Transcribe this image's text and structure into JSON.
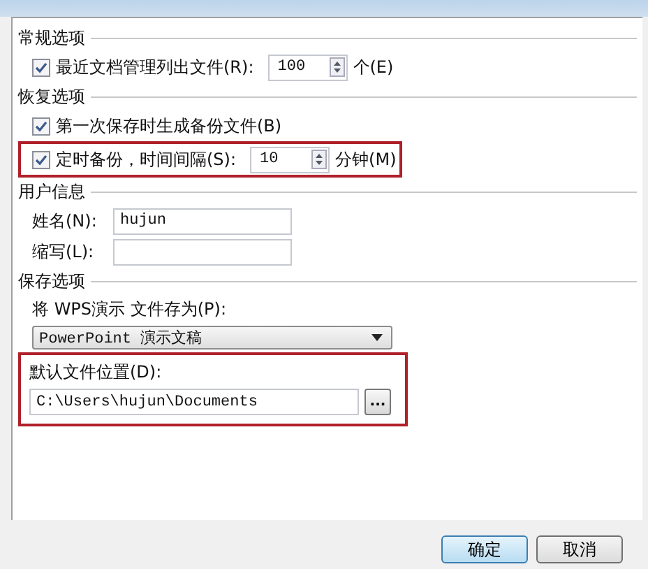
{
  "sections": [
    {
      "title": "常规选项",
      "rows": [
        {
          "kind": "checkbox-spin",
          "label": "最近文档管理列出文件(R):",
          "checked": true,
          "value": "100",
          "unit": "个(E)",
          "highlighted": false
        }
      ]
    },
    {
      "title": "恢复选项",
      "rows": [
        {
          "kind": "checkbox",
          "label": "第一次保存时生成备份文件(B)",
          "checked": true,
          "highlighted": false
        },
        {
          "kind": "checkbox-spin",
          "label": "定时备份，时间间隔(S):",
          "checked": true,
          "value": "10",
          "unit": "分钟(M)",
          "highlighted": true
        }
      ]
    },
    {
      "title": "用户信息",
      "rows": [
        {
          "kind": "text-field",
          "label": "姓名(N):",
          "value": "hujun",
          "highlighted": false
        },
        {
          "kind": "text-field",
          "label": "缩写(L):",
          "highlighted": false
        }
      ]
    },
    {
      "title": "保存选项",
      "rows": [
        {
          "kind": "dropdown",
          "label": "将 WPS演示 文件存为(P):",
          "value": "PowerPoint 演示文稿",
          "highlighted": false
        },
        {
          "kind": "path-field",
          "label": "默认文件位置(D):",
          "value": "C:\\Users\\hujun\\Documents",
          "browse": "...",
          "highlighted": true
        }
      ]
    }
  ],
  "buttons": [
    "确定",
    "取消"
  ]
}
